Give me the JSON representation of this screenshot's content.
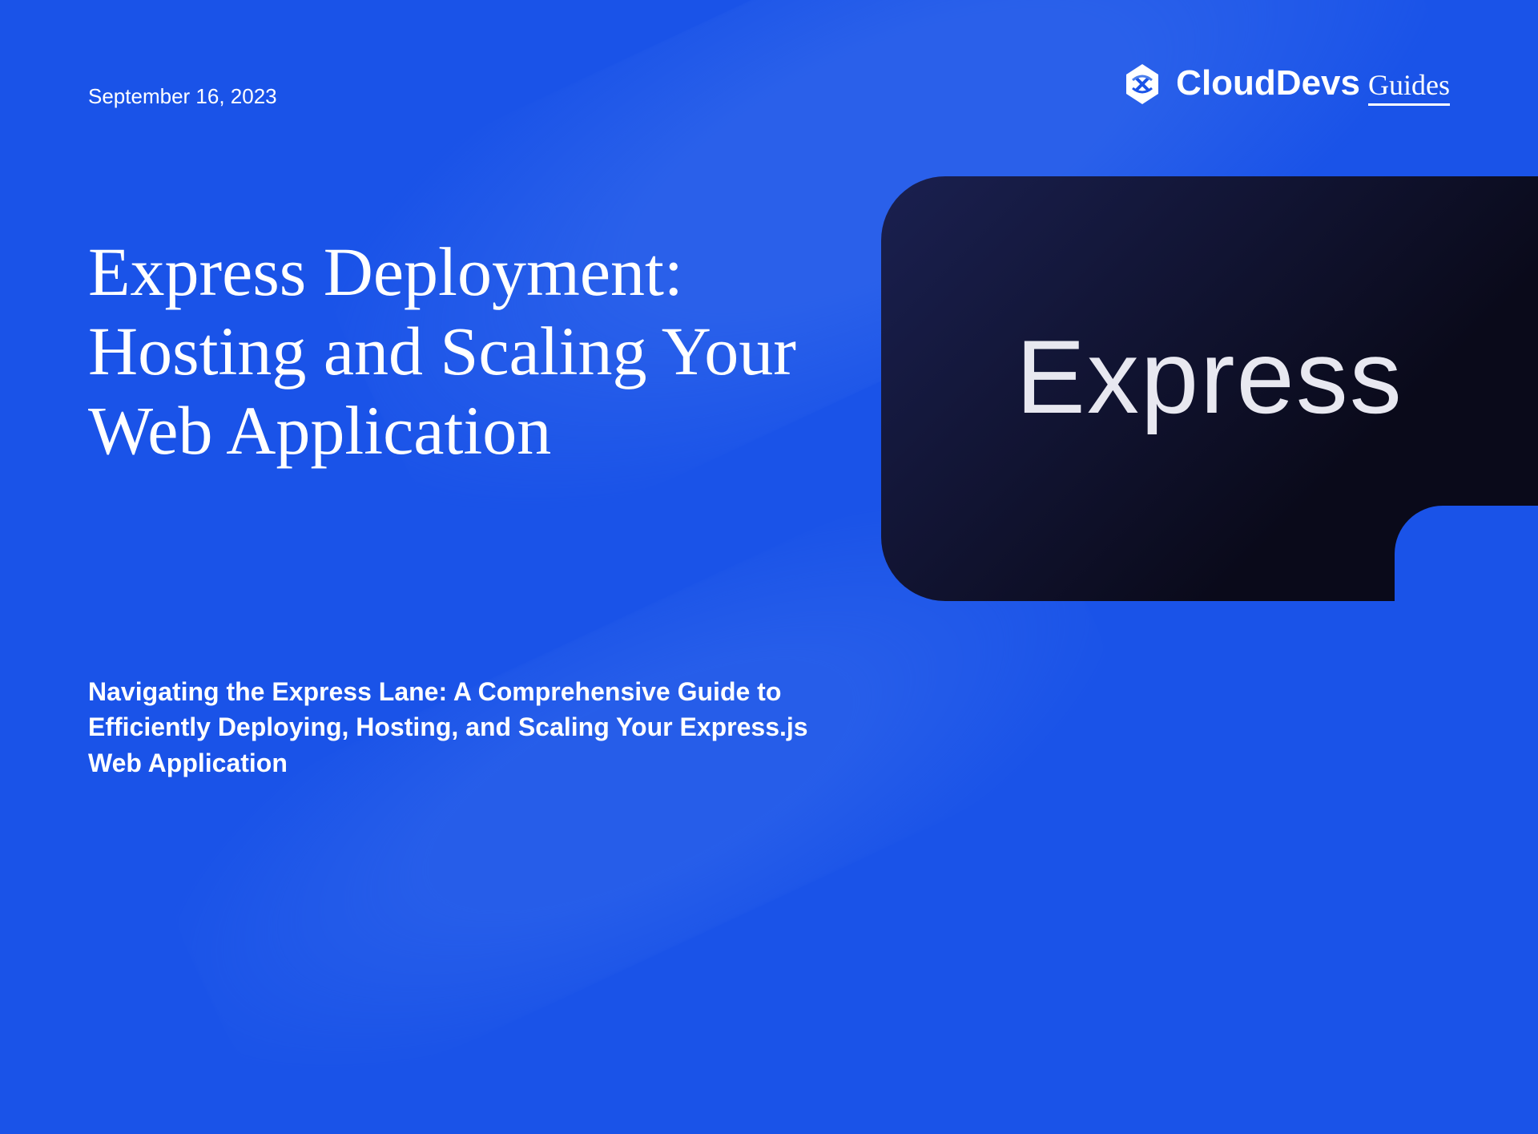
{
  "date": "September 16, 2023",
  "brand": {
    "main": "CloudDevs",
    "sub": "Guides"
  },
  "title": "Express Deployment: Hosting and Scaling Your Web Application",
  "subtitle": "Navigating the Express Lane: A Comprehensive Guide to Efficiently Deploying, Hosting, and Scaling Your Express.js Web Application",
  "card": {
    "label": "Express"
  }
}
